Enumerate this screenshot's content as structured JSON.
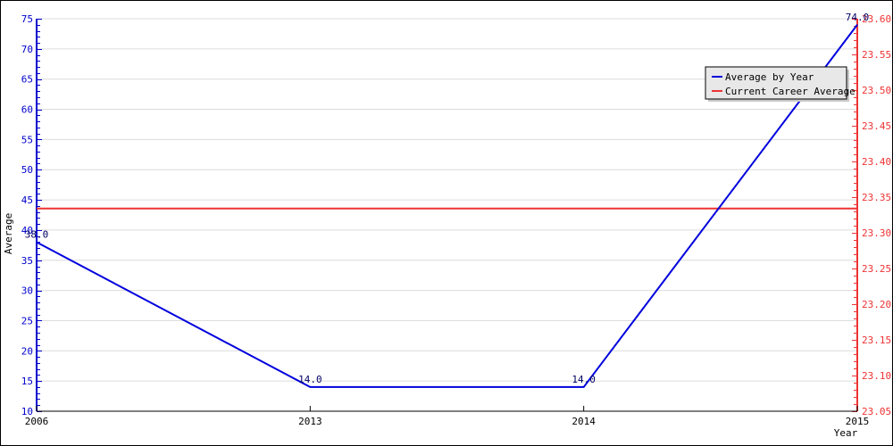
{
  "chart_data": {
    "type": "line",
    "title": "",
    "xlabel": "Year",
    "ylabel": "Average",
    "categories": [
      "2006",
      "2013",
      "2014",
      "2015"
    ],
    "left_axis": {
      "ylim": [
        10,
        75
      ],
      "major_step": 5,
      "minor_step": 1,
      "color": "#0000cc",
      "tick_labels": [
        "10",
        "15",
        "20",
        "25",
        "30",
        "35",
        "40",
        "45",
        "50",
        "55",
        "60",
        "65",
        "70",
        "75"
      ]
    },
    "right_axis": {
      "ylim": [
        23.05,
        23.6
      ],
      "major_step": 0.05,
      "minor_step": 0.01,
      "color": "#ee3333",
      "tick_labels": [
        "23.05",
        "23.10",
        "23.15",
        "23.20",
        "23.25",
        "23.30",
        "23.35",
        "23.40",
        "23.45",
        "23.50",
        "23.55",
        "23.60"
      ]
    },
    "series": [
      {
        "name": "Average by Year",
        "axis": "left",
        "color": "#0000dd",
        "values": [
          38.0,
          14.0,
          14.0,
          74.0
        ],
        "data_labels": [
          "38.0",
          "14.0",
          "14.0",
          "74.0"
        ]
      },
      {
        "name": "Current Career Average",
        "axis": "right",
        "color": "#ee3333",
        "constant": 23.334
      }
    ],
    "grid": true,
    "legend": {
      "placement": "top-right",
      "entries": [
        "Average by Year",
        "Current Career Average"
      ]
    }
  }
}
